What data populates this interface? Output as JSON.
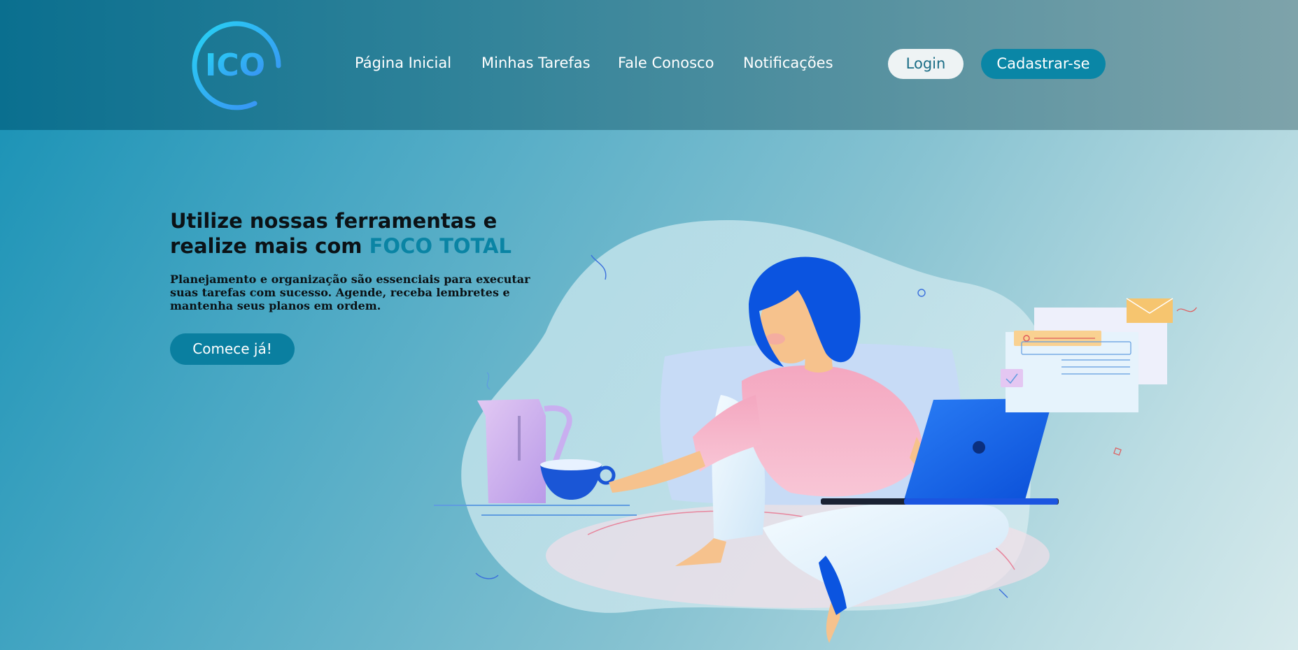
{
  "header": {
    "logo_text": "ICO",
    "nav": [
      {
        "label": "Página Inicial"
      },
      {
        "label": "Minhas Tarefas"
      },
      {
        "label": "Fale Conosco"
      },
      {
        "label": "Notificações"
      }
    ],
    "login_label": "Login",
    "signup_label": "Cadastrar-se"
  },
  "hero": {
    "title_line1": "Utilize nossas ferramentas e",
    "title_line2_prefix": "realize mais com ",
    "title_accent": "FOCO TOTAL",
    "subtitle_line1": "Planejamento e organização são essenciais para executar",
    "subtitle_line2": "suas tarefas com sucesso. Agende, receba lembretes e",
    "subtitle_line3": "mantenha seus planos em ordem.",
    "cta_label": "Comece já!"
  },
  "colors": {
    "accent": "#0a84a4",
    "logo_gradient_start": "#27d3f3",
    "logo_gradient_end": "#3b8cf5",
    "header_start": "#0a6f8f",
    "header_end": "#7ea3aa"
  }
}
